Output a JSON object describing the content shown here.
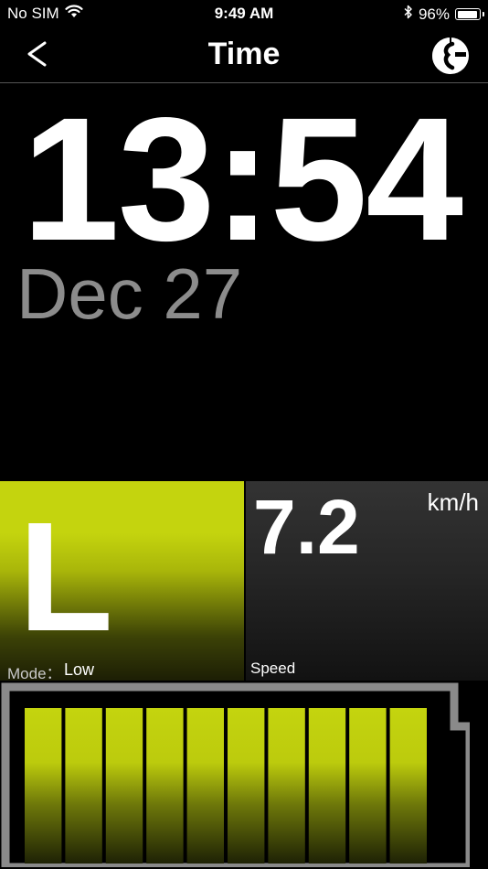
{
  "status_bar": {
    "carrier": "No SIM",
    "time": "9:49 AM",
    "battery_percent": "96%",
    "battery_level": 0.96,
    "icons": [
      "wifi-icon",
      "bluetooth-icon",
      "battery-icon"
    ]
  },
  "nav": {
    "back_label": "<",
    "title": "Time",
    "logo_icon": "brand-logo-icon"
  },
  "clock": {
    "time": "13:54",
    "date": "Dec 27"
  },
  "mode": {
    "letter": "L",
    "label": "Mode：",
    "value": "Low"
  },
  "speed": {
    "value": "7.2",
    "unit": "km/h",
    "label": "Speed"
  },
  "battery_gauge": {
    "segments_total": 10,
    "segments_filled": 10
  },
  "colors": {
    "accent": "#c4d40e",
    "background": "#000000",
    "date_gray": "#8c8c8c",
    "battery_frame": "#8a8a8a"
  }
}
